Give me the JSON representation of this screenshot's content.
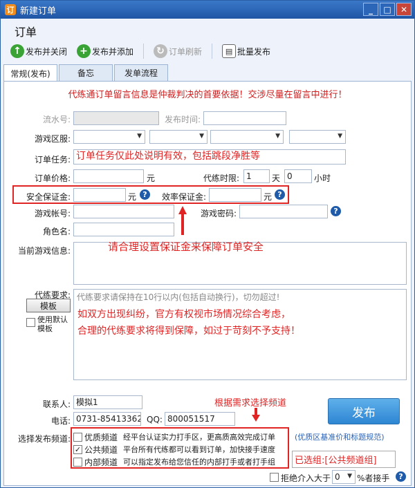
{
  "window": {
    "title": "新建订单",
    "min_label": "_",
    "max_label": "□",
    "close_label": "✕"
  },
  "header": {
    "title": "订单"
  },
  "toolbar": {
    "publish_close": "发布并关闭",
    "publish_add": "发布并添加",
    "refresh": "订单刷新",
    "batch": "批量发布"
  },
  "tabs": [
    "常规(发布)",
    "备忘",
    "发单流程"
  ],
  "notice": "代练通订单留言信息是仲裁判决的首要依据！交涉尽量在留言中进行！",
  "form": {
    "serial_label": "流水号:",
    "publish_time_label": "发布时间:",
    "region_label": "游戏区服:",
    "task_label": "订单任务:",
    "task_value": "订单任务仅此处说明有效，包括跳段净胜等",
    "price_label": "订单价格:",
    "price_unit": "元",
    "timelimit_label": "代练时限:",
    "days_value": "1",
    "days_unit": "天",
    "hours_value": "0",
    "hours_unit": "小时",
    "safety_label": "安全保证金:",
    "safety_unit": "元",
    "efficiency_label": "效率保证金:",
    "efficiency_unit": "元",
    "account_label": "游戏帐号:",
    "password_label": "游戏密码:",
    "role_label": "角色名:",
    "current_info_label": "当前游戏信息:",
    "deposit_hint": "请合理设置保证金来保障订单安全",
    "requirement_label": "代练要求:",
    "template_button": "模板",
    "use_default_template": "使用默认模板",
    "requirement_placeholder": "代练要求请保持在10行以内(包括自动换行)，切勿超过!",
    "dispute_note_1": "如双方出现纠纷，官方有权视市场情况综合考虑，",
    "dispute_note_2": "合理的代练要求将得到保障，如过于苛刻不予支持！",
    "contact_label": "联系人:",
    "contact_value": "模拟1",
    "phone_label": "电话:",
    "phone_value": "0731-85413362",
    "qq_label": "QQ:",
    "qq_value": "800051517",
    "channel_hint": "根据需求选择频道",
    "publish_button": "发布",
    "channel_label": "选择发布频道:",
    "channels": [
      {
        "name": "优质频道",
        "desc": "经平台认证实力打手区，更高质高效完成订单",
        "checked": false
      },
      {
        "name": "公共频道",
        "desc": "平台所有代练都可以看到订单，加快接手速度",
        "checked": true
      },
      {
        "name": "内部频道",
        "desc": "可以指定发布给您信任的内部打手或者打手组",
        "checked": false
      }
    ],
    "premium_link": "(优质区基准价和标题规范)",
    "selected_group": "已选组:[公共频道组]",
    "reject_label": "拒绝介入大于",
    "reject_value": "0",
    "reject_suffix": "%者接手"
  }
}
